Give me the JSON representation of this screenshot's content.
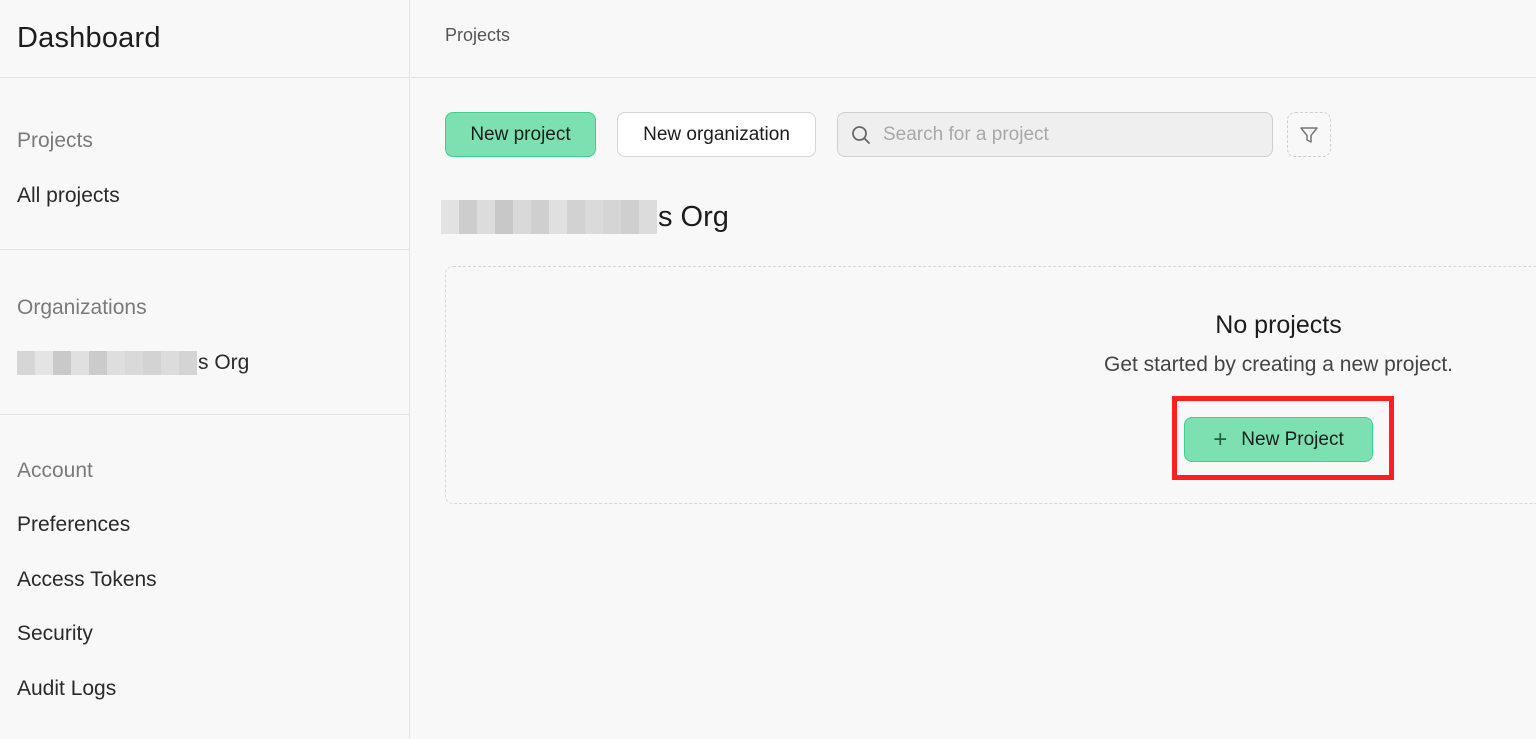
{
  "sidebar": {
    "title": "Dashboard",
    "projects_heading": "Projects",
    "all_projects": "All projects",
    "organizations_heading": "Organizations",
    "org_name_suffix": "s Org",
    "account_heading": "Account",
    "account_items": [
      "Preferences",
      "Access Tokens",
      "Security",
      "Audit Logs"
    ]
  },
  "topbar": {
    "breadcrumb": "Projects"
  },
  "toolbar": {
    "new_project": "New project",
    "new_organization": "New organization",
    "search_placeholder": "Search for a project"
  },
  "org_section": {
    "title_suffix": "s Org",
    "empty_title": "No projects",
    "empty_subtitle": "Get started by creating a new project.",
    "new_project_button": "New Project"
  },
  "colors": {
    "accent": "#7ce0b1",
    "accent_border": "#3ecf8e",
    "highlight": "#ff1f1f"
  }
}
